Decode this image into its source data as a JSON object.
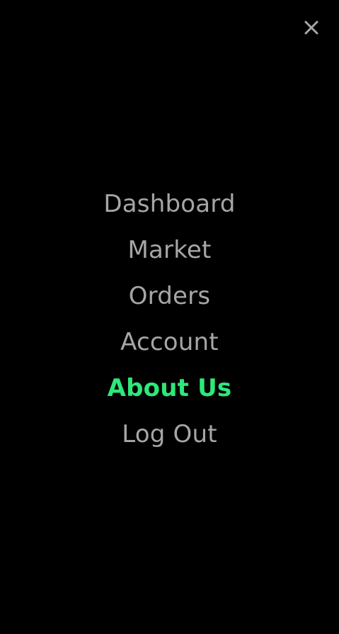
{
  "colors": {
    "background": "#000000",
    "item_text": "#a6a6a6",
    "active_text": "#2ee87a",
    "close_icon": "#a6a6a6"
  },
  "close_button": {
    "icon": "close-icon"
  },
  "menu": {
    "active_index": 4,
    "items": [
      {
        "label": "Dashboard"
      },
      {
        "label": "Market"
      },
      {
        "label": "Orders"
      },
      {
        "label": "Account"
      },
      {
        "label": "About Us"
      },
      {
        "label": "Log Out"
      }
    ]
  }
}
